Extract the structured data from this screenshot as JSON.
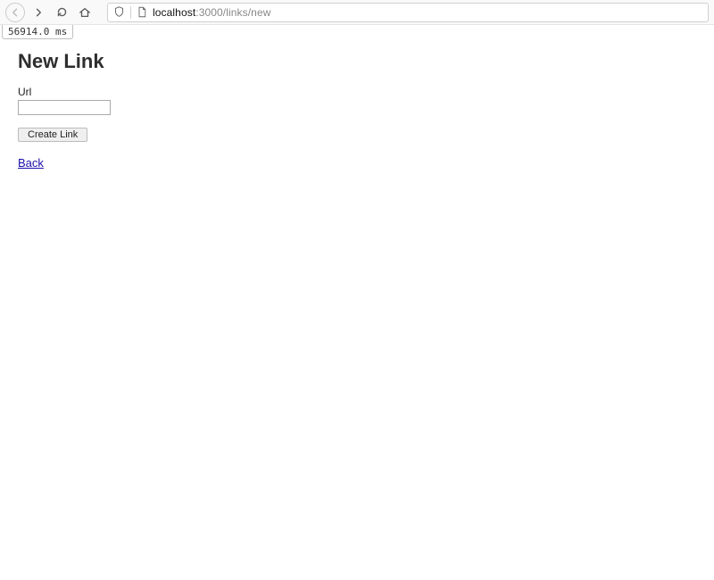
{
  "browser": {
    "url_host": "localhost",
    "url_rest": ":3000/links/new"
  },
  "debug": {
    "timing": "56914.0 ms"
  },
  "page": {
    "title": "New Link",
    "url_label": "Url",
    "submit_label": "Create Link",
    "back_label": "Back"
  }
}
